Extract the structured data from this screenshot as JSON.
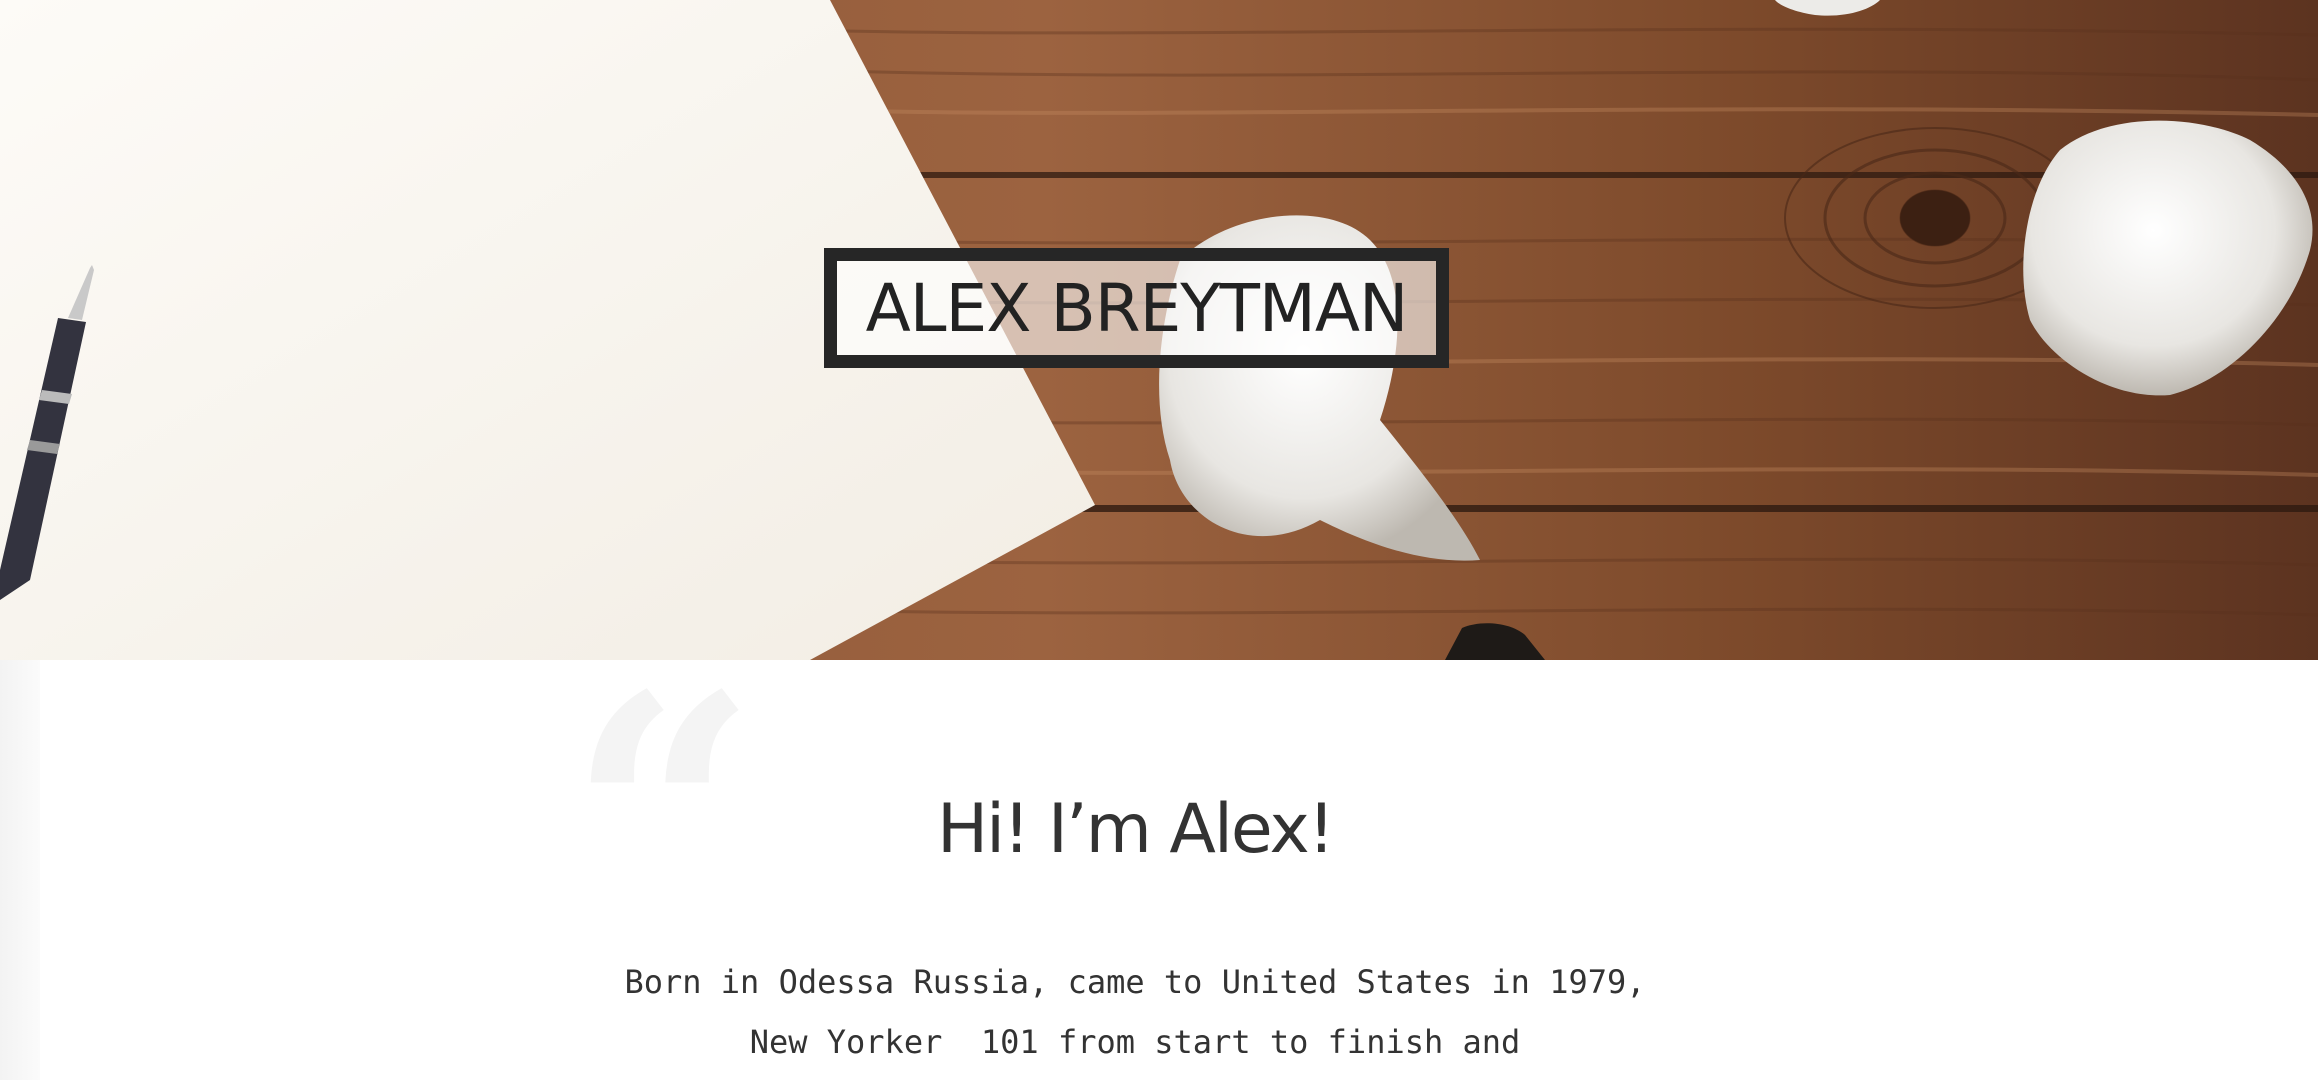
{
  "hero": {
    "title": "ALEX BREYTMAN"
  },
  "about": {
    "greeting": "Hi! I’m Alex!",
    "bio": "Born in Odessa Russia, came to United States in 1979, New Yorker  101 from start to finish and"
  },
  "decor": {
    "quote_mark": "“"
  },
  "colors": {
    "wood": "#7a4a2c",
    "paper": "#fbf8f2",
    "text": "#333333",
    "title_border": "#262626"
  }
}
